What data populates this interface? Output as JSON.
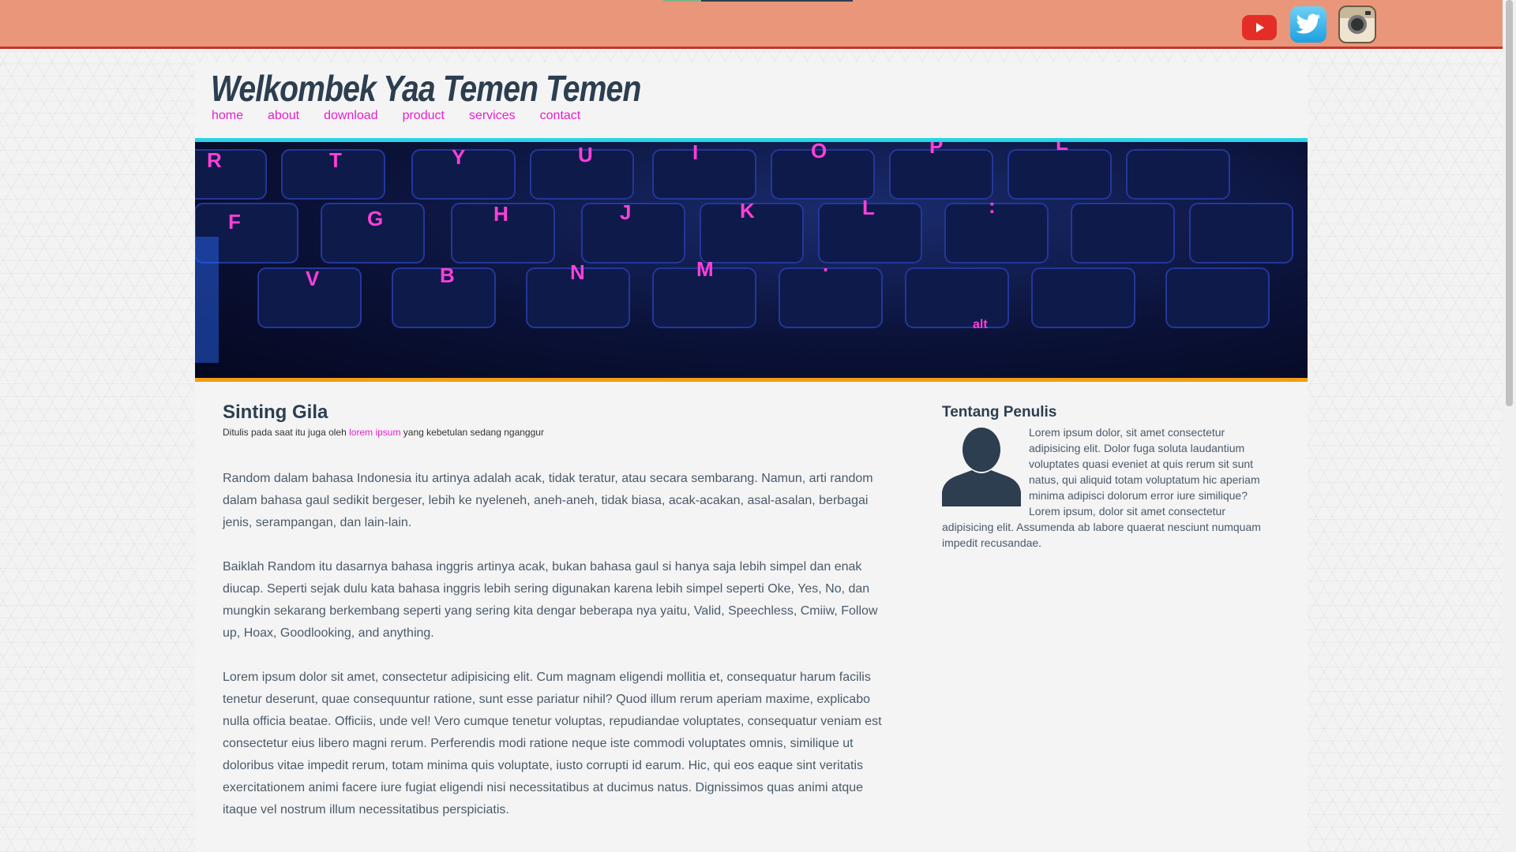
{
  "site": {
    "title": "Welkombek Yaa Temen Temen",
    "nav": [
      "home",
      "about",
      "download",
      "product",
      "services",
      "contact"
    ]
  },
  "social": [
    {
      "name": "youtube-icon",
      "color": "#e52d27"
    },
    {
      "name": "twitter-icon",
      "color": "#1d9fe0"
    },
    {
      "name": "instagram-icon",
      "color": "#c8b89a"
    }
  ],
  "banner": {
    "keys": [
      "R",
      "T",
      "Y",
      "U",
      "I",
      "O",
      "P",
      "L",
      "F",
      "G",
      "H",
      "J",
      "K",
      "L",
      ":",
      "V",
      "B",
      "N",
      "M",
      ".",
      "alt"
    ]
  },
  "article": {
    "title": "Sinting Gila",
    "meta_prefix": "Ditulis pada saat itu juga oleh ",
    "meta_author": "lorem ipsum",
    "meta_suffix": " yang kebetulan sedang nganggur",
    "paragraphs": [
      "Random dalam bahasa Indonesia itu artinya adalah acak, tidak teratur, atau secara sembarang. Namun, arti random dalam bahasa gaul sedikit bergeser, lebih ke nyeleneh, aneh-aneh, tidak biasa, acak-acakan, asal-asalan, berbagai jenis, serampangan, dan lain-lain.",
      "Baiklah Random itu dasarnya bahasa inggris artinya acak, bukan bahasa gaul si hanya saja lebih simpel dan enak diucap. Seperti sejak dulu kata bahasa inggris lebih sering digunakan karena lebih simpel seperti Oke, Yes, No, dan mungkin sekarang berkembang seperti yang sering kita dengar beberapa nya yaitu, Valid, Speechless, Cmiiw, Follow up, Hoax, Goodlooking, and anything.",
      "Lorem ipsum dolor sit amet, consectetur adipisicing elit. Cum magnam eligendi mollitia et, consequatur harum facilis tenetur deserunt, quae consequuntur ratione, sunt esse pariatur nihil? Quod illum rerum aperiam maxime, explicabo nulla officia beatae. Officiis, unde vel! Vero cumque tenetur voluptas, repudiandae voluptates, consequatur veniam est consectetur eius libero magni rerum. Perferendis modi ratione neque iste commodi voluptates omnis, similique ut doloribus vitae impedit rerum, totam minima quis voluptate, iusto corrupti id earum. Hic, qui eos eaque sint veritatis exercitationem animi facere iure fugiat eligendi nisi necessitatibus at ducimus natus. Dignissimos quas animi atque itaque vel nostrum illum necessitatibus perspiciatis."
    ]
  },
  "aside": {
    "title": "Tentang Penulis",
    "text": "Lorem ipsum dolor, sit amet consectetur adipisicing elit. Dolor fuga soluta laudantium voluptates quasi eveniet at quis rerum sit sunt natus, qui aliquid totam voluptatum hic aperiam minima adipisci dolorum error iure similique? Lorem ipsum, dolor sit amet consectetur adipisicing elit. Assumenda ab labore quaerat nesciunt numquam impedit recusandae."
  },
  "colors": {
    "topbar": "#e9967a",
    "topbar_border": "#c0392b",
    "nav_link": "#e91ed0",
    "heading": "#2c3e50",
    "banner_top_border": "#29d4e8",
    "banner_bottom_border": "#f39c12"
  }
}
